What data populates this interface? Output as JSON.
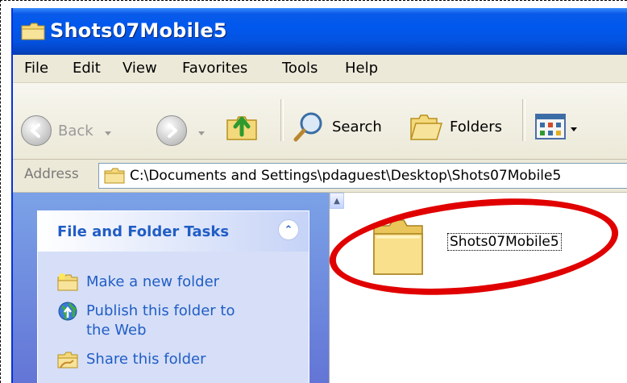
{
  "window": {
    "title": "Shots07Mobile5",
    "title_icon": "folder-icon"
  },
  "menu": {
    "items": [
      "File",
      "Edit",
      "View",
      "Favorites",
      "Tools",
      "Help"
    ]
  },
  "toolbar": {
    "back_label": "Back",
    "search_label": "Search",
    "folders_label": "Folders"
  },
  "address": {
    "label": "Address",
    "value": "C:\\Documents and Settings\\pdaguest\\Desktop\\Shots07Mobile5"
  },
  "task_pane": {
    "title": "File and Folder Tasks",
    "items": [
      {
        "label": "Make a new folder",
        "icon": "new-folder-icon"
      },
      {
        "label": "Publish this folder to the Web",
        "icon": "globe-icon"
      },
      {
        "label": "Share this folder",
        "icon": "share-folder-icon"
      }
    ]
  },
  "content": {
    "items": [
      {
        "name": "Shots07Mobile5",
        "icon": "folder-icon"
      }
    ]
  },
  "colors": {
    "titlebar": "#0058ee",
    "task_link": "#215dc6",
    "highlight_ring": "#e00000"
  }
}
